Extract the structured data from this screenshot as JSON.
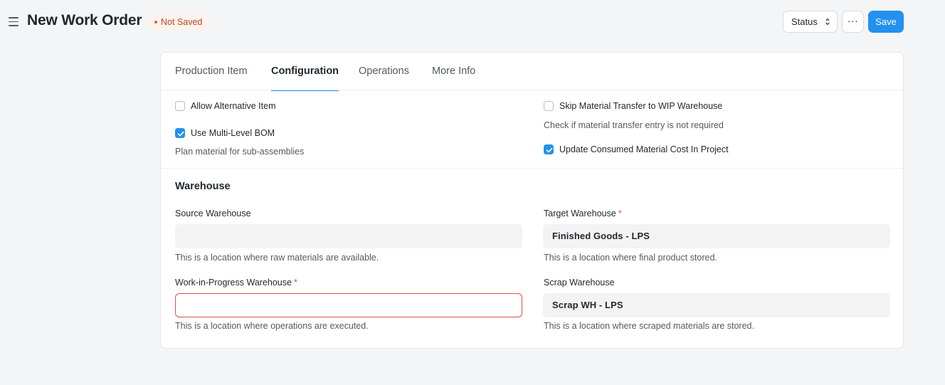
{
  "header": {
    "title": "New Work Order",
    "badge": "Not Saved",
    "status_button": "Status",
    "more_button": "···",
    "save_button": "Save"
  },
  "tabs": [
    {
      "label": "Production Item",
      "active": false
    },
    {
      "label": "Configuration",
      "active": true
    },
    {
      "label": "Operations",
      "active": false
    },
    {
      "label": "More Info",
      "active": false
    }
  ],
  "options": {
    "allow_alternative_item": {
      "label": "Allow Alternative Item",
      "checked": false
    },
    "use_multi_level_bom": {
      "label": "Use Multi-Level BOM",
      "checked": true,
      "help": "Plan material for sub-assemblies"
    },
    "skip_material_transfer": {
      "label": "Skip Material Transfer to WIP Warehouse",
      "checked": false,
      "help": "Check if material transfer entry is not required"
    },
    "update_consumed_cost": {
      "label": "Update Consumed Material Cost In Project",
      "checked": true
    }
  },
  "warehouse": {
    "section_title": "Warehouse",
    "source": {
      "label": "Source Warehouse",
      "value": "",
      "help": "This is a location where raw materials are available."
    },
    "target": {
      "label": "Target Warehouse",
      "required": "*",
      "value": "Finished Goods - LPS",
      "help": "This is a location where final product stored."
    },
    "wip": {
      "label": "Work-in-Progress Warehouse",
      "required": "*",
      "value": "",
      "help": "This is a location where operations are executed."
    },
    "scrap": {
      "label": "Scrap Warehouse",
      "value": "Scrap WH - LPS",
      "help": "This is a location where scraped materials are stored."
    }
  },
  "colors": {
    "accent": "#2490ef",
    "badge_text": "#c0471f",
    "error": "#e24c4c"
  }
}
